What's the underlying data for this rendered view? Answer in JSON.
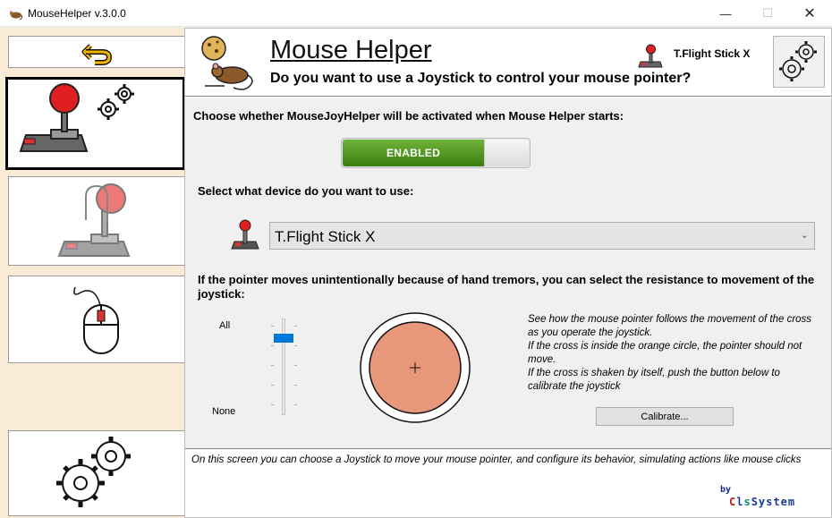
{
  "window": {
    "title": "MouseHelper v.3.0.0",
    "controls": {
      "minimize": "—",
      "maximize": "☐",
      "close": "✕"
    }
  },
  "sidebar": {
    "items": [
      {
        "name": "back",
        "icon": "undo-arrow-icon"
      },
      {
        "name": "joystick",
        "icon": "joystick-settings-icon",
        "selected": true
      },
      {
        "name": "tremor",
        "icon": "joystick-tremor-icon"
      },
      {
        "name": "mouse",
        "icon": "mouse-icon"
      },
      {
        "name": "settings",
        "icon": "gears-icon"
      }
    ]
  },
  "header": {
    "title": "Mouse Helper",
    "subtitle": "Do you want to use a Joystick to control your mouse pointer?",
    "device": "T.Flight Stick X"
  },
  "activation": {
    "label": "Choose whether MouseJoyHelper will be activated when Mouse Helper starts:",
    "toggle_label": "ENABLED",
    "enabled": true
  },
  "device_select": {
    "label": "Select what device do you want to use:",
    "value": "T.Flight Stick X"
  },
  "resistance": {
    "label": "If the pointer moves unintentionally because of hand tremors, you can select the resistance to movement of the joystick:",
    "slider_top_label": "All",
    "slider_bottom_label": "None",
    "slider_level_fraction_from_top": 0.17,
    "explanation": "See how the mouse pointer follows the movement of the cross as you operate the joystick.\nIf the cross is inside the orange circle, the pointer should not move.\nIf the cross is shaken by itself, push the button below to calibrate the joystick",
    "calibrate_label": "Calibrate..."
  },
  "footer": {
    "text": "On this screen you can choose a Joystick to move your mouse pointer, and configure  its behavior, simulating actions like mouse clicks",
    "by": "by",
    "brand_parts": [
      "C",
      "l",
      "s",
      "System"
    ]
  },
  "colors": {
    "sidebar_bg": "#faebd7",
    "toggle_green": "#4a8f1e",
    "dead_zone": "#e8977a",
    "slider_thumb": "#0078d7",
    "brand_red": "#c01818",
    "brand_blue": "#1a3a9a",
    "brand_teal": "#139080"
  }
}
